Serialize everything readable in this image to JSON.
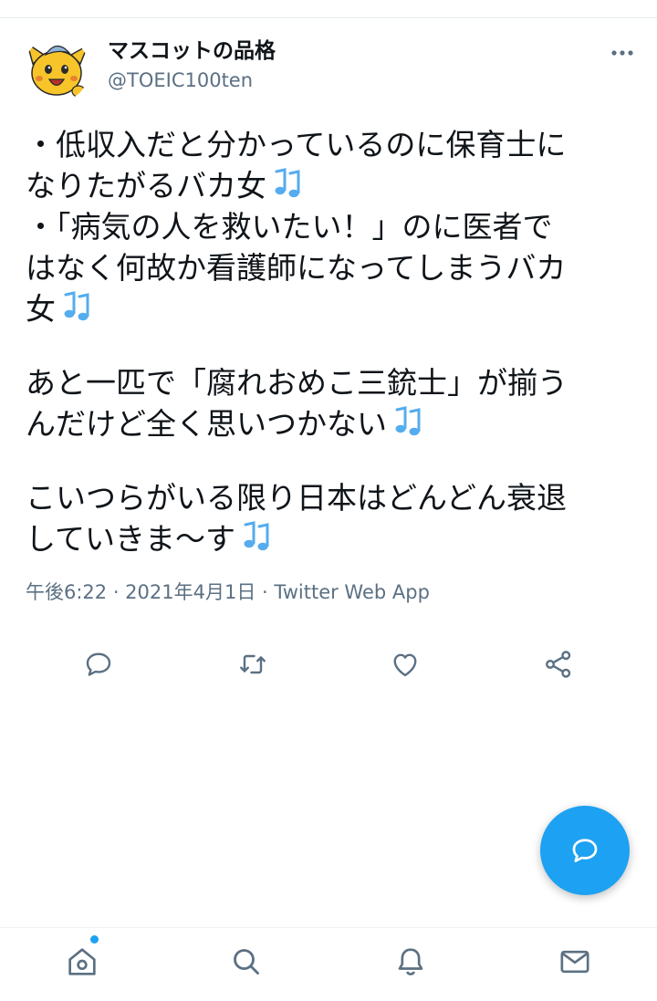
{
  "user": {
    "display_name": "マスコットの品格",
    "handle": "@TOEIC100ten"
  },
  "tweet": {
    "lines": [
      {
        "text": "・低収入だと分かっているのに保育士に",
        "note": false
      },
      {
        "text": "なりたがるバカ女",
        "note": true
      },
      {
        "text": "・「病気の人を救いたい！」のに医者で",
        "note": false
      },
      {
        "text": "はなく何故か看護師になってしまうバカ",
        "note": false
      },
      {
        "text": "女",
        "note": true
      },
      {
        "text": "",
        "note": false
      },
      {
        "text": "あと一匹で「腐れおめこ三銃士」が揃う",
        "note": false
      },
      {
        "text": "んだけど全く思いつかない",
        "note": true
      },
      {
        "text": "",
        "note": false
      },
      {
        "text": "こいつらがいる限り日本はどんどん衰退",
        "note": false
      },
      {
        "text": "していきま〜す",
        "note": true
      }
    ],
    "meta": "午後6:22 · 2021年4月1日 · Twitter Web App"
  },
  "icons": {
    "more": "more-dots-icon",
    "reply": "reply-bubble-icon",
    "retweet": "retweet-icon",
    "like": "heart-icon",
    "share": "share-icon",
    "compose": "compose-reply-icon",
    "home": "home-icon",
    "search": "search-icon",
    "notifications": "bell-icon",
    "messages": "envelope-icon",
    "note": "musical-notes-emoji"
  },
  "colors": {
    "accent": "#1da1f2",
    "secondary_text": "#5b7083",
    "icon_gray": "#5b7083",
    "emoji_blue": "#55acee"
  }
}
